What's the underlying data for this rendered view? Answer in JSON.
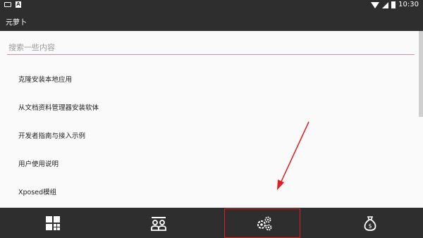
{
  "status_bar": {
    "time": "10:30",
    "a_badge": "A"
  },
  "app": {
    "title": "元萝卜"
  },
  "search": {
    "placeholder": "搜索一些内容"
  },
  "list_items": [
    "克隆安装本地应用",
    "从文档资料管理器安装软体",
    "开发者指南与接入示例",
    "用户使用说明",
    "Xposed模组"
  ],
  "bottom_nav": {
    "tabs": [
      {
        "icon": "apps-grid-icon"
      },
      {
        "icon": "people-icon"
      },
      {
        "icon": "settings-icon"
      },
      {
        "icon": "money-bag-icon"
      }
    ]
  },
  "colors": {
    "dark": "#2e2e2e",
    "accent_underline": "#e48aa4",
    "annotation_red": "#e02020"
  }
}
